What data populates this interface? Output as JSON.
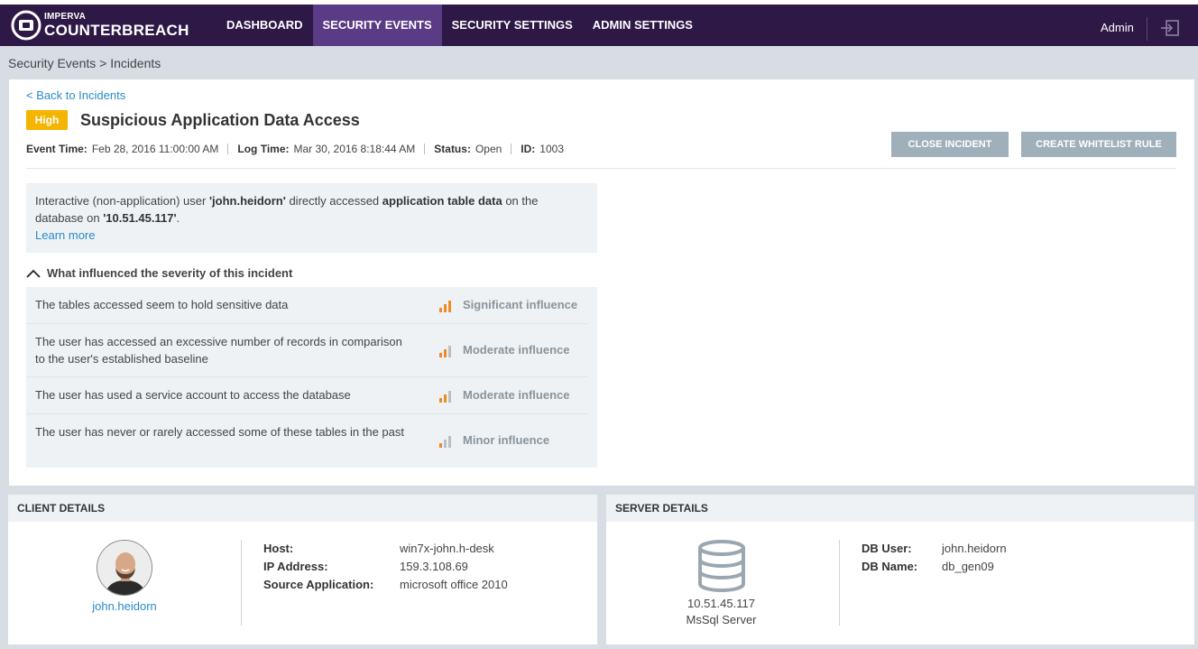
{
  "brand": {
    "top": "IMPERVA",
    "bottom": "COUNTERBREACH"
  },
  "nav": {
    "items": [
      {
        "label": "DASHBOARD"
      },
      {
        "label": "SECURITY EVENTS"
      },
      {
        "label": "SECURITY SETTINGS"
      },
      {
        "label": "ADMIN SETTINGS"
      }
    ],
    "user": "Admin",
    "logout_icon": "logout-icon"
  },
  "breadcrumb": "Security Events > Incidents",
  "incident": {
    "back_link": "< Back to Incidents",
    "severity": "High",
    "title": "Suspicious Application Data Access",
    "meta": {
      "event_time_label": "Event Time:",
      "event_time": "Feb 28, 2016 11:00:00 AM",
      "log_time_label": "Log Time:",
      "log_time": "Mar 30, 2016 8:18:44 AM",
      "status_label": "Status:",
      "status": "Open",
      "id_label": "ID:",
      "id": "1003"
    },
    "buttons": {
      "close": "CLOSE INCIDENT",
      "whitelist": "CREATE WHITELIST RULE"
    },
    "description": {
      "p1": "Interactive (non-application) user ",
      "user": "'john.heidorn'",
      "p2": " directly accessed ",
      "target": "application table data",
      "p3": " on the database on ",
      "ip": "'10.51.45.117'",
      "p4": ".",
      "learn_more": "Learn more"
    },
    "severity_heading": "What influenced the severity of this incident",
    "factors": [
      {
        "text": "The tables accessed seem to hold sensitive data",
        "influence": "Significant influence",
        "level": 3
      },
      {
        "text": "The user has accessed an excessive number of records in comparison to the user's established baseline",
        "influence": "Moderate influence",
        "level": 2
      },
      {
        "text": "The user has used a service account to access the database",
        "influence": "Moderate influence",
        "level": 2
      },
      {
        "text": "The user has never or rarely accessed some of these tables in the past",
        "influence": "Minor influence",
        "level": 1
      }
    ]
  },
  "client": {
    "heading": "CLIENT DETAILS",
    "username": "john.heidorn",
    "host_label": "Host:",
    "host": "win7x-john.h-desk",
    "ip_label": "IP Address:",
    "ip": "159.3.108.69",
    "app_label": "Source Application:",
    "app": "microsoft office 2010"
  },
  "server": {
    "heading": "SERVER DETAILS",
    "ip": "10.51.45.117",
    "type": "MsSql Server",
    "db_user_label": "DB User:",
    "db_user": "john.heidorn",
    "db_name_label": "DB Name:",
    "db_name": "db_gen09"
  },
  "colors": {
    "nav_bg": "#2d1846",
    "nav_active": "#5b3a86",
    "severity_high": "#f5b400",
    "link": "#2a8ac8",
    "influence_orange": "#f08a24",
    "button": "#9fb0bb"
  }
}
